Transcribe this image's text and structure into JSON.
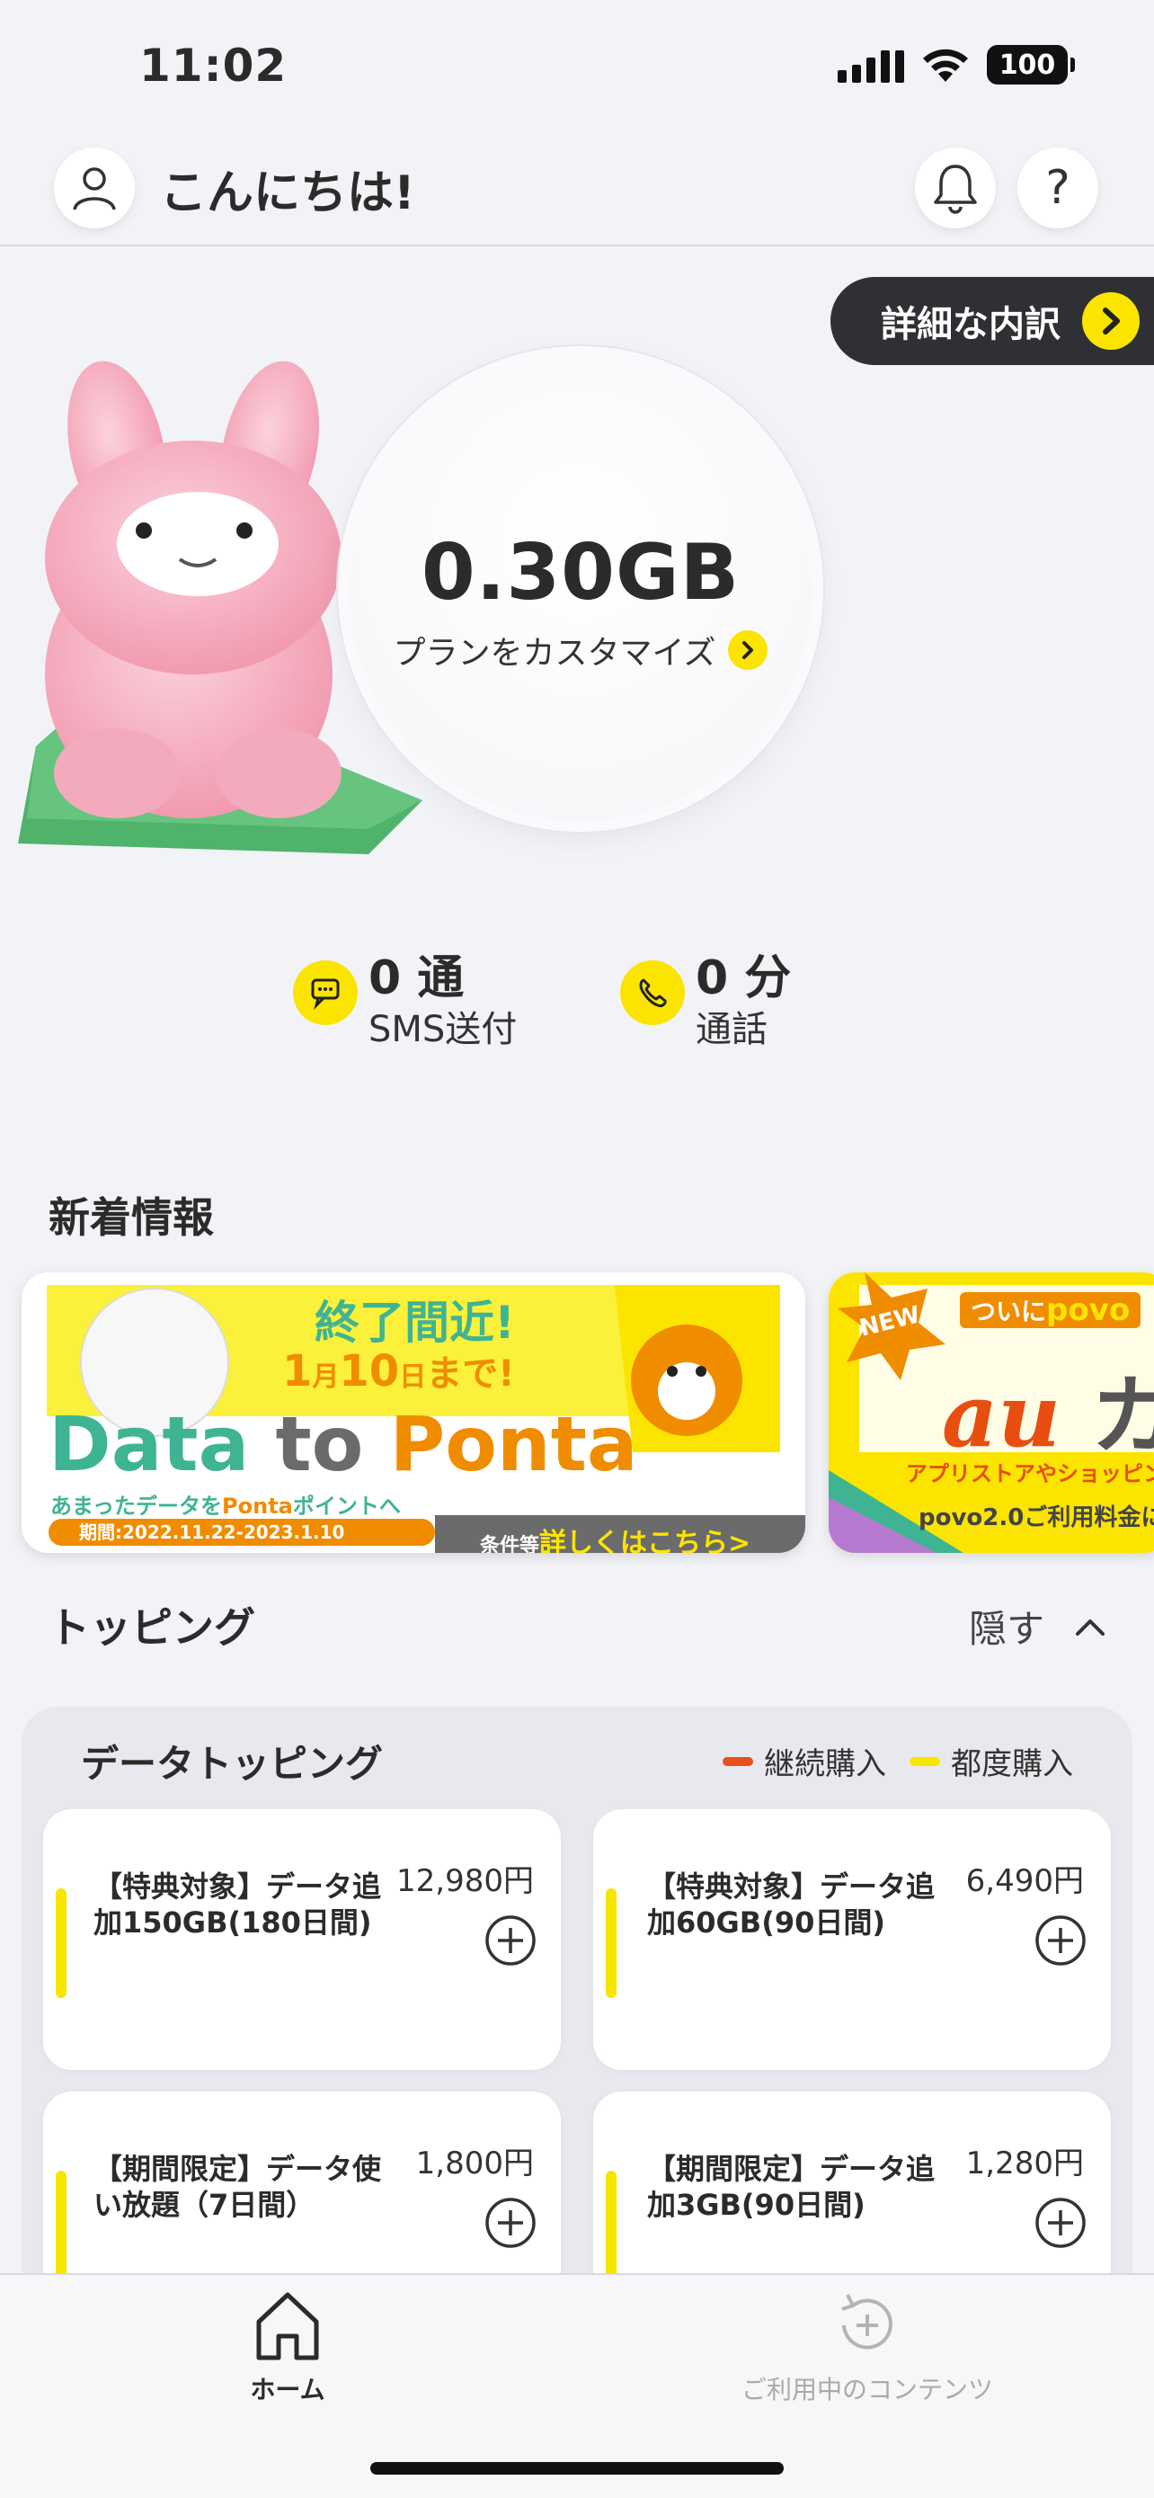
{
  "status_bar": {
    "time": "11:02",
    "battery": "100"
  },
  "header": {
    "greeting": "こんにちは!"
  },
  "detail_button": {
    "label": "詳細な内訳"
  },
  "data_balance": {
    "amount": "0.30GB",
    "plan_link_label": "プランをカスタマイズ"
  },
  "stats": {
    "sms": {
      "value": "0 通",
      "label": "SMS送付"
    },
    "call": {
      "value": "0 分",
      "label": "通話"
    }
  },
  "news": {
    "title": "新着情報",
    "banner1": {
      "headline": "終了間近!",
      "until_month": "1",
      "until_month_unit": "月",
      "until_day": "10",
      "until_day_unit": "日",
      "until_suffix": "まで!",
      "title_data": "Data",
      "title_to": "to",
      "title_ponta": "Ponta",
      "desc_prefix": "あまったデータを",
      "desc_ponta": "Ponta",
      "desc_suffix": "ポイントへ",
      "period": "期間:2022.11.22-2023.1.10",
      "cta_prefix": "条件等",
      "cta": "詳しくはこちら>"
    },
    "banner2": {
      "badge": "NEW",
      "headline_prefix": "ついに",
      "headline_brand": "povo",
      "logo": "au",
      "logo_tail": "カ",
      "line1": "アプリストアやショッピング",
      "line2": "povo2.0ご利用料金に"
    }
  },
  "topping": {
    "title": "トッピング",
    "toggle_label": "隠す",
    "data_section": {
      "title": "データトッピング",
      "legend": [
        {
          "label": "継続購入",
          "color": "#e8501c"
        },
        {
          "label": "都度購入",
          "color": "#f7e600"
        }
      ],
      "items": [
        {
          "name": "【特典対象】データ追加150GB(180日間)",
          "price": "12,980円"
        },
        {
          "name": "【特典対象】データ追加60GB(90日間)",
          "price": "6,490円"
        },
        {
          "name": "【期間限定】データ使い放題（7日間）",
          "price": "1,800円"
        },
        {
          "name": "【期間限定】データ追加3GB(90日間)",
          "price": "1,280円"
        }
      ]
    }
  },
  "bottom_nav": {
    "home": "ホーム",
    "content": "ご利用中のコンテンツ"
  },
  "colors": {
    "accent_yellow": "#fbe400",
    "dark": "#2f3033",
    "ponta_orange": "#f08c00",
    "teal": "#3fb493"
  }
}
